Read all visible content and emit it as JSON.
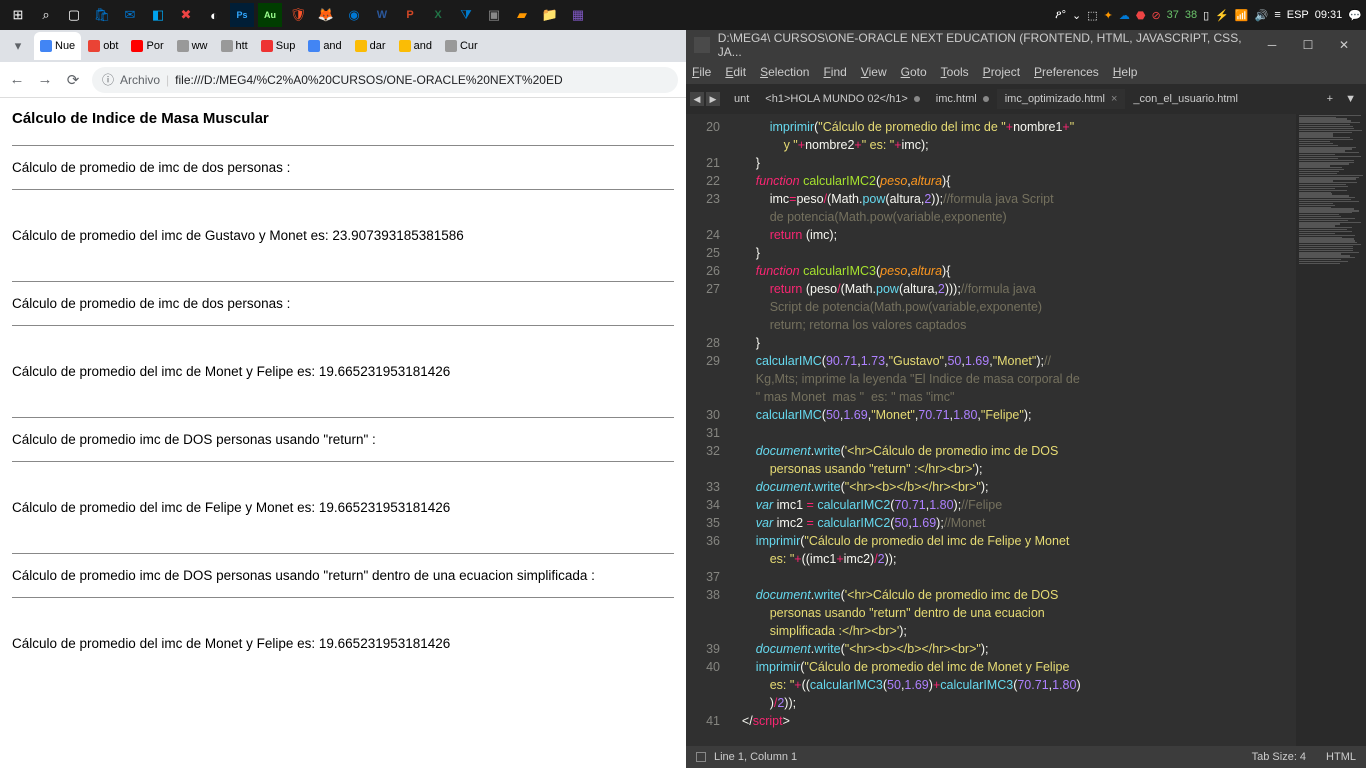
{
  "taskbar": {
    "tray": {
      "n1": "37",
      "n2": "38",
      "lang": "ESP",
      "time": "09:31"
    }
  },
  "browser": {
    "tabs": [
      {
        "label": "Nue",
        "color": "#4285f4"
      },
      {
        "label": "obt",
        "color": "#ea4335"
      },
      {
        "label": "Por",
        "color": "#ff0000"
      },
      {
        "label": "ww",
        "color": "#999"
      },
      {
        "label": "htt",
        "color": "#999"
      },
      {
        "label": "Sup",
        "color": "#e33"
      },
      {
        "label": "and",
        "color": "#4285f4"
      },
      {
        "label": "dar",
        "color": "#fbbc05"
      },
      {
        "label": "and",
        "color": "#fbbc05"
      },
      {
        "label": "Cur",
        "color": "#999"
      }
    ],
    "url_prefix": "Archivo",
    "url": "file:///D:/MEG4/%C2%A0%20CURSOS/ONE-ORACLE%20NEXT%20ED",
    "page": {
      "title": "Cálculo de Indice de Masa Muscular",
      "lines": [
        "Cálculo de promedio de imc de dos personas :",
        "Cálculo de promedio del imc de Gustavo y Monet es: 23.907393185381586",
        "Cálculo de promedio de imc de dos personas :",
        "Cálculo de promedio del imc de Monet y Felipe es: 19.665231953181426",
        "Cálculo de promedio imc de DOS personas usando \"return\" :",
        "Cálculo de promedio del imc de Felipe y Monet es: 19.665231953181426",
        "Cálculo de promedio imc de DOS personas usando \"return\" dentro de una ecuacion simplificada :",
        "Cálculo de promedio del imc de Monet y Felipe es: 19.665231953181426"
      ]
    }
  },
  "sublime": {
    "title": "D:\\MEG4\\  CURSOS\\ONE-ORACLE NEXT EDUCATION (FRONTEND, HTML, JAVASCRIPT, CSS, JA...",
    "menu": [
      "File",
      "Edit",
      "Selection",
      "Find",
      "View",
      "Goto",
      "Tools",
      "Project",
      "Preferences",
      "Help"
    ],
    "tabs": [
      {
        "label": "unt",
        "dirty": false
      },
      {
        "label": "<h1>HOLA MUNDO 02</h1>",
        "dirty": true
      },
      {
        "label": "imc.html",
        "dirty": true
      },
      {
        "label": "imc_optimizado.html",
        "active": true
      },
      {
        "label": "_con_el_usuario.html",
        "dirty": false
      }
    ],
    "gutter": [
      "20",
      "",
      "21",
      "22",
      "23",
      "",
      "24",
      "25",
      "26",
      "27",
      "",
      "",
      "28",
      "29",
      "",
      "",
      "30",
      "31",
      "32",
      "",
      "33",
      "34",
      "35",
      "36",
      "",
      "37",
      "38",
      "",
      "",
      "39",
      "40",
      "",
      "",
      "41"
    ],
    "status": {
      "left": "Line 1, Column 1",
      "tabsize": "Tab Size: 4",
      "syntax": "HTML"
    }
  }
}
